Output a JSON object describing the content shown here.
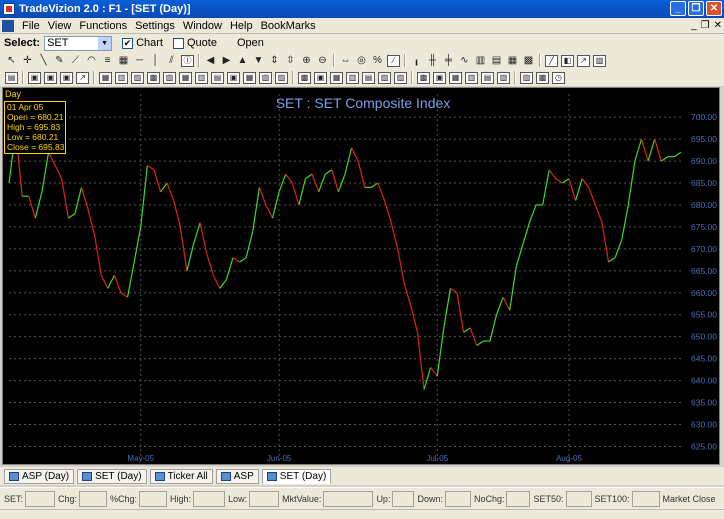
{
  "window": {
    "title": "TradeVizion 2.0 : F1 - [SET (Day)]"
  },
  "menu": [
    "File",
    "View",
    "Functions",
    "Settings",
    "Window",
    "Help",
    "BookMarks"
  ],
  "selectbar": {
    "label": "Select:",
    "symbol": "SET",
    "chart_label": "Chart",
    "chart_checked": true,
    "quote_label": "Quote",
    "quote_checked": false,
    "open_label": "Open"
  },
  "chart": {
    "period_label": "Day",
    "info": {
      "date": "01 Apr 05",
      "open": "Open = 680.21",
      "high": "High = 695.83",
      "low": "Low = 680.21",
      "close": "Close = 695.83"
    }
  },
  "chart_data": {
    "type": "line",
    "title": "SET : SET Composite Index",
    "ylim": [
      621,
      703
    ],
    "yticks": [
      625,
      630,
      635,
      640,
      645,
      650,
      655,
      660,
      665,
      670,
      675,
      680,
      685,
      690,
      695,
      700
    ],
    "ytick_labels": [
      "625.00",
      "630.00",
      "635.00",
      "640.00",
      "645.00",
      "650.00",
      "655.00",
      "660.00",
      "665.00",
      "670.00",
      "675.00",
      "680.00",
      "685.00",
      "690.00",
      "695.00",
      "700.00"
    ],
    "x_labels": [
      {
        "label": "May-05",
        "index": 20
      },
      {
        "label": "Jun-05",
        "index": 41
      },
      {
        "label": "Jul-05",
        "index": 65
      },
      {
        "label": "Aug-05",
        "index": 85
      }
    ],
    "n_points": 107,
    "values": [
      685,
      697,
      682,
      682,
      677,
      683,
      692,
      689,
      686,
      677,
      678,
      684,
      679,
      673,
      664,
      661,
      664,
      660,
      659,
      667,
      675,
      689,
      688,
      683,
      685,
      681,
      675,
      665,
      671,
      676,
      669,
      664,
      661,
      663,
      668,
      667,
      668,
      674,
      684,
      680,
      677,
      683,
      687,
      685,
      680,
      686,
      687,
      683,
      687,
      688,
      683,
      687,
      693,
      690,
      684,
      684,
      685,
      681,
      676,
      670,
      662,
      657,
      651,
      638,
      643,
      641,
      652,
      661,
      660,
      651,
      652,
      648,
      649,
      649,
      655,
      659,
      656,
      666,
      671,
      676,
      680,
      680,
      688,
      686,
      685,
      686,
      681,
      686,
      684,
      680,
      676,
      667,
      668,
      672,
      680,
      690,
      695,
      690,
      695,
      690,
      691,
      691,
      692
    ],
    "up_color": "#3cdc28",
    "down_color": "#e02020",
    "grid": true,
    "grid_color": "#555555",
    "title_color": "#7ba0e6",
    "tick_color": "#4a6fb8"
  },
  "tabs": [
    "ASP (Day)",
    "SET (Day)",
    "Ticker All",
    "ASP",
    "SET (Day)"
  ],
  "status": [
    {
      "label": "SET:",
      "w": 30
    },
    {
      "label": "Chg:",
      "w": 28
    },
    {
      "label": "%Chg:",
      "w": 28
    },
    {
      "label": "High:",
      "w": 32
    },
    {
      "label": "Low:",
      "w": 30
    },
    {
      "label": "MktValue:",
      "w": 50
    },
    {
      "label": "Up:",
      "w": 22
    },
    {
      "label": "Down:",
      "w": 26
    },
    {
      "label": "NoChg:",
      "w": 24
    },
    {
      "label": "SET50:",
      "w": 26
    },
    {
      "label": "SET100:",
      "w": 28
    },
    {
      "label": "Market Close",
      "w": 0
    }
  ]
}
